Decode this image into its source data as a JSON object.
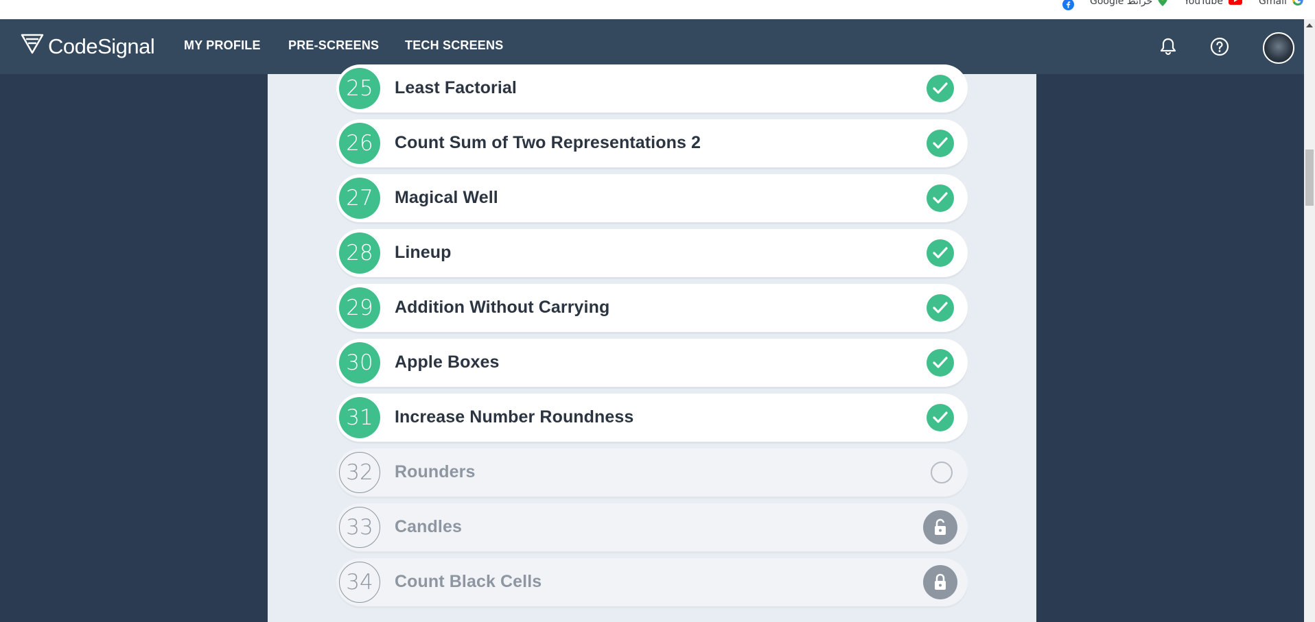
{
  "bookmarks": [
    {
      "label": "Google خرائط",
      "icon": "google-maps-icon"
    },
    {
      "label": "YouTube",
      "icon": "youtube-icon"
    },
    {
      "label": "Gmail",
      "icon": "google-icon"
    }
  ],
  "brand": {
    "name": "CodeSignal"
  },
  "nav": {
    "profile": "MY PROFILE",
    "prescreens": "PRE-SCREENS",
    "techscreens": "TECH SCREENS"
  },
  "tasks": [
    {
      "number": "25",
      "title": "Least Factorial",
      "status": "completed"
    },
    {
      "number": "26",
      "title": "Count Sum of Two Representations 2",
      "status": "completed"
    },
    {
      "number": "27",
      "title": "Magical Well",
      "status": "completed"
    },
    {
      "number": "28",
      "title": "Lineup",
      "status": "completed"
    },
    {
      "number": "29",
      "title": "Addition Without Carrying",
      "status": "completed"
    },
    {
      "number": "30",
      "title": "Apple Boxes",
      "status": "completed"
    },
    {
      "number": "31",
      "title": "Increase Number Roundness",
      "status": "completed"
    },
    {
      "number": "32",
      "title": "Rounders",
      "status": "available"
    },
    {
      "number": "33",
      "title": "Candles",
      "status": "unlocked"
    },
    {
      "number": "34",
      "title": "Count Black Cells",
      "status": "locked"
    }
  ],
  "colors": {
    "accent": "#3ebf8b",
    "nav_bg": "#34495e",
    "page_bg": "#2b3b51",
    "panel_bg": "#e8edf3",
    "muted": "#8d96a1"
  }
}
